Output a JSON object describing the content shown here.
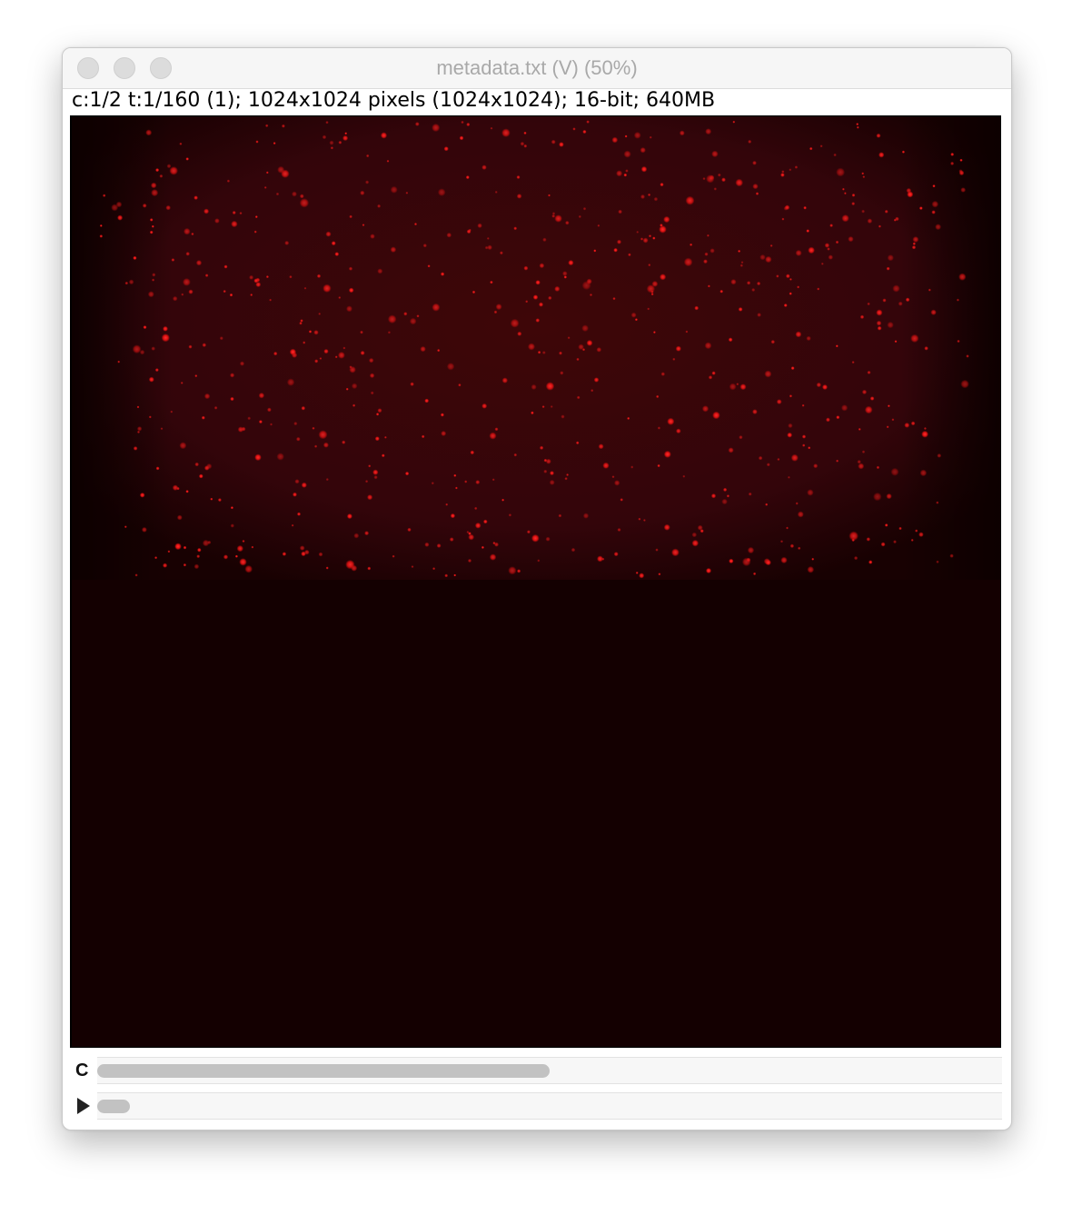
{
  "window": {
    "title": "metadata.txt (V) (50%)",
    "info": "c:1/2 t:1/160 (1); 1024x1024 pixels (1024x1024); 16-bit; 640MB"
  },
  "image": {
    "colors": {
      "background": "#140001",
      "signal_band": "#3a0506",
      "spot": "#ff1a1a"
    }
  },
  "sliders": {
    "channel": {
      "label": "C",
      "value": 1,
      "max": 2
    },
    "time": {
      "value": 1,
      "max": 160
    }
  }
}
